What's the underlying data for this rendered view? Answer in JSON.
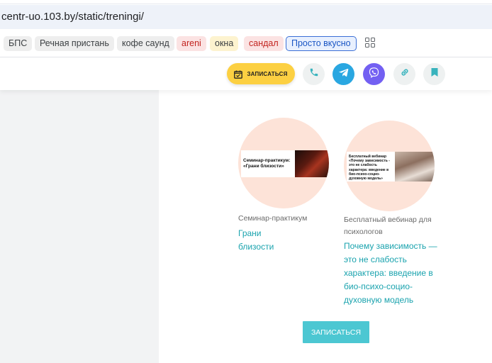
{
  "browser": {
    "url": "centr-uo.103.by/static/treningi/"
  },
  "bookmarks": [
    {
      "label": "БПС",
      "style": "gray"
    },
    {
      "label": "Речная пристань",
      "style": "gray"
    },
    {
      "label": "кофе саунд",
      "style": "gray"
    },
    {
      "label": "areni",
      "style": "red"
    },
    {
      "label": "окна",
      "style": "yellow"
    },
    {
      "label": "сандал",
      "style": "red"
    },
    {
      "label": "Просто вкусно",
      "style": "outline"
    }
  ],
  "header": {
    "signup_label": "ЗАПИСАТЬСЯ",
    "accent_color": "#fcd042",
    "contact_icons": [
      "phone-icon",
      "telegram-icon",
      "viber-icon",
      "link-icon",
      "bookmark-icon"
    ]
  },
  "cards": [
    {
      "image_text": "Семинар-практикум: «Грани близости»",
      "category": "Семинар-практикум",
      "title_lines": [
        "Грани",
        "близости"
      ]
    },
    {
      "image_text": "Бесплатный вебинар «Почему зависимость - это не слабость характера: введение в био-психо-социо-духовную модель»",
      "category_lines": [
        "Бесплатный вебинар для",
        "психологов"
      ],
      "title_lines": [
        "Почему зависимость —",
        "это не слабость",
        "характера: введение в",
        "био-психо-социо-",
        "духовную модель"
      ]
    }
  ],
  "footer": {
    "signup_label": "ЗАПИСАТЬСЯ",
    "accent_color": "#4cc7d2"
  }
}
